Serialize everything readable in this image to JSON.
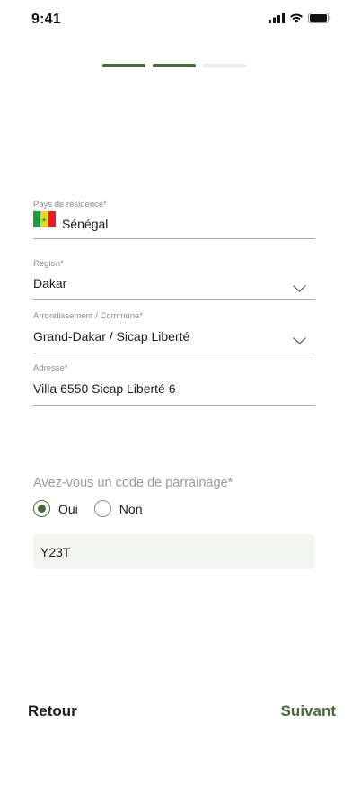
{
  "status_bar": {
    "time": "9:41"
  },
  "progress": {
    "total_steps": 3,
    "completed_steps": 2
  },
  "form": {
    "country": {
      "label": "Pays de résidence*",
      "value": "Sénégal",
      "flag_icon": "senegal-flag-icon"
    },
    "region": {
      "label": "Région*",
      "value": "Dakar"
    },
    "arrondissement": {
      "label": "Arrondissement / Commune*",
      "value": "Grand-Dakar / Sicap Liberté"
    },
    "address": {
      "label": "Adresse*",
      "value": "Villa 6550 Sicap Liberté 6"
    }
  },
  "referral": {
    "question": "Avez-vous un code de parrainage*",
    "options": [
      {
        "label": "Oui",
        "selected": true
      },
      {
        "label": "Non",
        "selected": false
      }
    ],
    "code": "Y23T"
  },
  "footer": {
    "back_label": "Retour",
    "next_label": "Suivant"
  },
  "colors": {
    "accent": "#4a6b38",
    "input_background": "#f3f5f1",
    "muted_text": "#8a8a8a"
  }
}
